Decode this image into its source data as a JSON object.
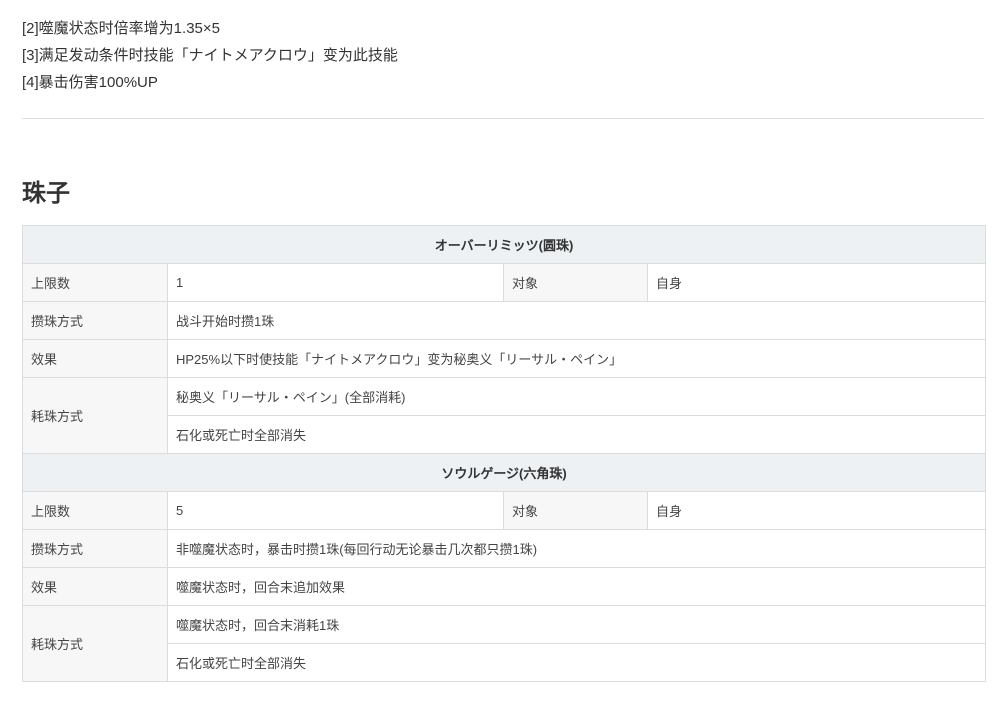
{
  "notes": [
    "[2]噬魔状态时倍率增为1.35×5",
    "[3]满足发动条件时技能「ナイトメアクロウ」变为此技能",
    "[4]暴击伤害100%UP"
  ],
  "section_title": "珠子",
  "orbs": [
    {
      "name": "オーバーリミッツ(圆珠)",
      "limit_label": "上限数",
      "limit": "1",
      "target_label": "对象",
      "target": "自身",
      "gain_label": "攒珠方式",
      "gain": "战斗开始时攒1珠",
      "effect_label": "效果",
      "effect": "HP25%以下时使技能「ナイトメアクロウ」变为秘奥义「リーサル・ペイン」",
      "consume_label": "耗珠方式",
      "consume": [
        "秘奥义「リーサル・ペイン」(全部消耗)",
        "石化或死亡时全部消失"
      ]
    },
    {
      "name": "ソウルゲージ(六角珠)",
      "limit_label": "上限数",
      "limit": "5",
      "target_label": "对象",
      "target": "自身",
      "gain_label": "攒珠方式",
      "gain": "非噬魔状态时，暴击时攒1珠(每回行动无论暴击几次都只攒1珠)",
      "effect_label": "效果",
      "effect": "噬魔状态时，回合末追加效果",
      "consume_label": "耗珠方式",
      "consume": [
        "噬魔状态时，回合末消耗1珠",
        "石化或死亡时全部消失"
      ]
    }
  ]
}
